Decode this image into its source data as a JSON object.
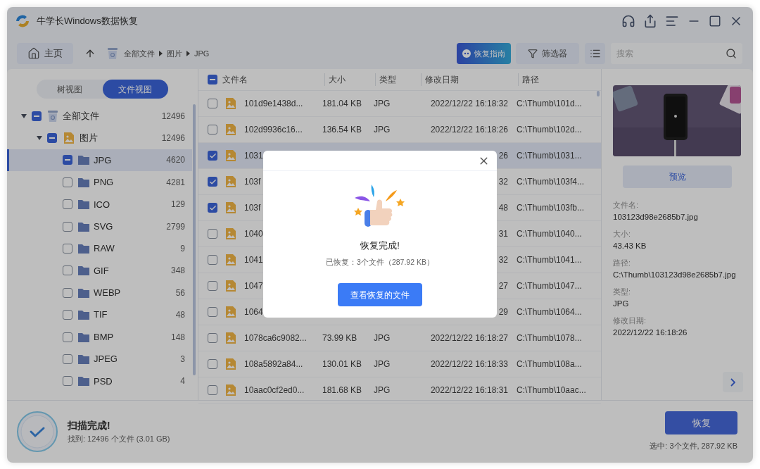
{
  "window": {
    "title": "牛学长Windows数据恢复"
  },
  "toolbar": {
    "home": "主页",
    "breadcrumb": [
      "全部文件",
      "图片",
      "JPG"
    ],
    "guide_button": "恢复指南",
    "filter_button": "筛选器",
    "search": {
      "placeholder": "搜索"
    }
  },
  "view_toggle": [
    {
      "label": "树视图",
      "selected": false
    },
    {
      "label": "文件视图",
      "selected": true
    }
  ],
  "tree": [
    {
      "kind": "drive",
      "label": "全部文件",
      "count": "12496",
      "indeterminate": true,
      "expanded": true,
      "selected": false,
      "children": [
        {
          "kind": "images",
          "label": "图片",
          "count": "12496",
          "indeterminate": true,
          "expanded": true,
          "selected": false,
          "children": [
            {
              "kind": "folder",
              "label": "JPG",
              "count": "4620",
              "indeterminate": true,
              "selected": true
            },
            {
              "kind": "folder",
              "label": "PNG",
              "count": "4281",
              "checked": false,
              "indeterminate": false,
              "selected": false
            },
            {
              "kind": "folder",
              "label": "ICO",
              "count": "129",
              "checked": false,
              "indeterminate": false,
              "selected": false
            },
            {
              "kind": "folder",
              "label": "SVG",
              "count": "2799",
              "checked": false,
              "indeterminate": false,
              "selected": false
            },
            {
              "kind": "folder",
              "label": "RAW",
              "count": "9",
              "checked": false,
              "indeterminate": false,
              "selected": false
            },
            {
              "kind": "folder",
              "label": "GIF",
              "count": "348",
              "checked": false,
              "indeterminate": false,
              "selected": false
            },
            {
              "kind": "folder",
              "label": "WEBP",
              "count": "56",
              "checked": false,
              "indeterminate": false,
              "selected": false
            },
            {
              "kind": "folder",
              "label": "TIF",
              "count": "48",
              "checked": false,
              "indeterminate": false,
              "selected": false
            },
            {
              "kind": "folder",
              "label": "BMP",
              "count": "148",
              "checked": false,
              "indeterminate": false,
              "selected": false
            },
            {
              "kind": "folder",
              "label": "JPEG",
              "count": "3",
              "checked": false,
              "indeterminate": false,
              "selected": false
            },
            {
              "kind": "folder",
              "label": "PSD",
              "count": "4",
              "checked": false,
              "indeterminate": false,
              "selected": false
            }
          ]
        }
      ]
    }
  ],
  "table": {
    "header_indeterminate": true,
    "columns": [
      "文件名",
      "大小",
      "类型",
      "修改日期",
      "路径"
    ],
    "rows": [
      {
        "name": "101d9e1438d...",
        "size": "181.04 KB",
        "type": "JPG",
        "date": "2022/12/22 16:18:32",
        "path": "C:\\Thumb\\101d...",
        "checked": false,
        "selected": false
      },
      {
        "name": "102d9936c16...",
        "size": "136.54 KB",
        "type": "JPG",
        "date": "2022/12/22 16:18:26",
        "path": "C:\\Thumb\\102d...",
        "checked": false,
        "selected": false
      },
      {
        "name": "1031",
        "date": "26",
        "path": "C:\\Thumb\\1031...",
        "checked": true,
        "selected": true
      },
      {
        "name": "103f",
        "date": "32",
        "path": "C:\\Thumb\\103f4...",
        "checked": true,
        "selected": false
      },
      {
        "name": "103f",
        "date": "48",
        "path": "C:\\Thumb\\103fb...",
        "checked": true,
        "selected": false
      },
      {
        "name": "1040",
        "date": "31",
        "path": "C:\\Thumb\\1040...",
        "checked": false,
        "selected": false
      },
      {
        "name": "1041",
        "date": "32",
        "path": "C:\\Thumb\\1041...",
        "checked": false,
        "selected": false
      },
      {
        "name": "1047",
        "date": "27",
        "path": "C:\\Thumb\\1047...",
        "checked": false,
        "selected": false
      },
      {
        "name": "1064",
        "date": "29",
        "path": "C:\\Thumb\\1064...",
        "checked": false,
        "selected": false
      },
      {
        "name": "1078ca6c9082...",
        "size": "73.99 KB",
        "type": "JPG",
        "date": "2022/12/22 16:18:27",
        "path": "C:\\Thumb\\1078...",
        "checked": false,
        "selected": false
      },
      {
        "name": "108a5892a84...",
        "size": "130.01 KB",
        "type": "JPG",
        "date": "2022/12/22 16:18:33",
        "path": "C:\\Thumb\\108a...",
        "checked": false,
        "selected": false
      },
      {
        "name": "10aac0cf2ed0...",
        "size": "181.68 KB",
        "type": "JPG",
        "date": "2022/12/22 16:18:31",
        "path": "C:\\Thumb\\10aac...",
        "checked": false,
        "selected": false
      }
    ]
  },
  "details": {
    "preview_button": "预览",
    "fields": [
      {
        "label": "文件名:",
        "value": "103123d98e2685b7.jpg"
      },
      {
        "label": "大小:",
        "value": "43.43 KB"
      },
      {
        "label": "路径:",
        "value": "C:\\Thumb\\103123d98e2685b7.jpg"
      },
      {
        "label": "类型:",
        "value": "JPG"
      },
      {
        "label": "修改日期:",
        "value": "2022/12/22 16:18:26"
      }
    ]
  },
  "status": {
    "title": "扫描完成!",
    "found": "找到: 12496 个文件 (3.01 GB)",
    "restore_button": "恢复",
    "selection": "选中: 3个文件, 287.92 KB"
  },
  "dialog": {
    "title": "恢复完成!",
    "summary": "已恢复：3个文件（287.92 KB）",
    "button": "查看恢复的文件"
  }
}
